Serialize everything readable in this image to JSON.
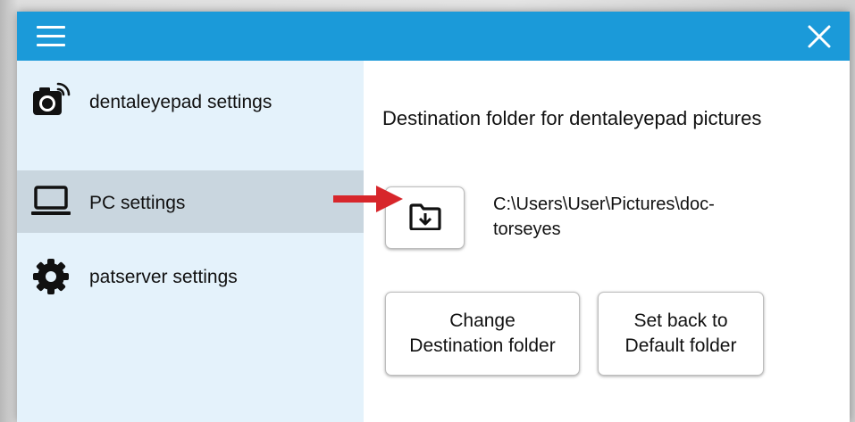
{
  "titlebar": {
    "menu_icon": "hamburger-menu-icon",
    "close_icon": "close-icon",
    "accent_color": "#1b9ad9"
  },
  "sidebar": {
    "background": "#e4f2fb",
    "active_background": "#c9d6df",
    "items": [
      {
        "label": "dentaleyepad settings",
        "icon": "camera-wireless-icon",
        "active": false
      },
      {
        "label": "PC settings",
        "icon": "laptop-icon",
        "active": true
      },
      {
        "label": "patserver settings",
        "icon": "gear-icon",
        "active": false
      }
    ]
  },
  "main": {
    "destination_title": "Destination folder for dentaleyepad pictures",
    "folder_button_icon": "folder-download-icon",
    "path_line1": "C:\\Users\\User\\Pictures\\doc-",
    "path_line2": "torseyes",
    "change_button": {
      "line1": "Change",
      "line2": "Destination folder"
    },
    "reset_button": {
      "line1": "Set back to",
      "line2": "Default folder"
    },
    "pointer_arrow_color": "#d7262b"
  }
}
